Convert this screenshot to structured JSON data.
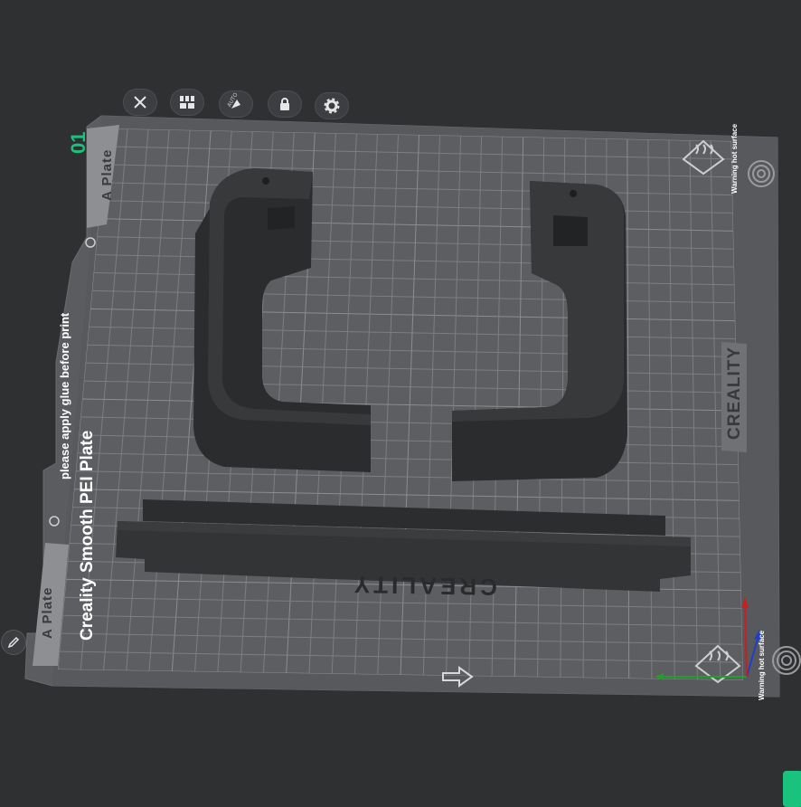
{
  "toolbar": {
    "buttons": [
      {
        "name": "remove-plate-button",
        "icon": "close-icon"
      },
      {
        "name": "arrange-button",
        "icon": "grid-icon"
      },
      {
        "name": "auto-orient-button",
        "icon": "auto-orient-icon",
        "tag": "AUTO"
      },
      {
        "name": "lock-plate-button",
        "icon": "lock-icon"
      },
      {
        "name": "plate-settings-button",
        "icon": "gear-icon"
      }
    ]
  },
  "plate": {
    "number": "01",
    "tab_top": "A Plate",
    "tab_bottom": "A Plate",
    "glue_note": "please apply glue before print",
    "plate_name": "Creality Smooth PEI Plate",
    "brand": "CREALITY",
    "warning_top": "Warning hot surface",
    "warning_bottom": "Warning hot surface",
    "model_text": "CREALITY"
  },
  "colors": {
    "background": "#2f3032",
    "plate": "#5a5b5e",
    "grid": "#7e7f82",
    "model": "#2c2d2f",
    "accent": "#19c37d",
    "axis_x": "#1fa02a",
    "axis_y": "#1f3fc8",
    "axis_z": "#c81f1f"
  }
}
